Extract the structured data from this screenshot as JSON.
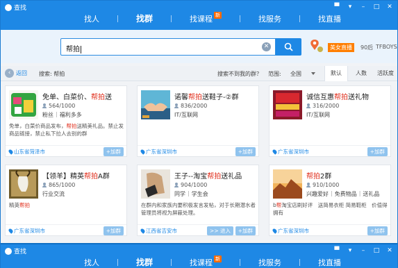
{
  "window": {
    "title": "查找"
  },
  "nav": {
    "tabs": [
      {
        "label": "找人",
        "active": false
      },
      {
        "label": "找群",
        "active": true
      },
      {
        "label": "找课程",
        "active": false,
        "badge": "新"
      },
      {
        "label": "找服务",
        "active": false
      },
      {
        "label": "找直播",
        "active": false
      }
    ]
  },
  "search": {
    "value": "帮拍"
  },
  "promo": {
    "tag": "美女直播",
    "words": [
      "90后",
      "TFBOYS"
    ]
  },
  "filter": {
    "back_label": "返回",
    "crumb": "搜索: 帮拍",
    "not_found": "搜索不到我的群？",
    "range_label": "范围:",
    "range_value": "全国",
    "sort": [
      "默认",
      "人数",
      "活跃度"
    ],
    "sort_active": 0
  },
  "cards": [
    {
      "name_pre": "免单、白菜价、",
      "name_hl": "帮拍",
      "name_post": "送",
      "members": "564/1000",
      "tags": [
        "粉丝",
        "福利多多"
      ],
      "desc_pre": "免单，白菜价商品发布，",
      "desc_hl": "帮拍",
      "desc_post": "送精美礼品。禁止发商品链接，禁止私下拉人去别的群",
      "location": "山东省菏泽市",
      "join": "+加群",
      "enter": ""
    },
    {
      "name_pre": "诺馨",
      "name_hl": "帮拍",
      "name_post": "送鞋子-②群",
      "members": "836/2000",
      "tags": [
        "IT/互联网"
      ],
      "desc_pre": "",
      "desc_hl": "",
      "desc_post": "",
      "location": "广东省深圳市",
      "join": "+加群",
      "enter": ""
    },
    {
      "name_pre": "诚信互惠",
      "name_hl": "帮拍",
      "name_post": "送礼物",
      "members": "316/2000",
      "tags": [
        "IT/互联网"
      ],
      "desc_pre": "",
      "desc_hl": "",
      "desc_post": "",
      "location": "广东省深圳市",
      "join": "+加群",
      "enter": ""
    },
    {
      "name_pre": "【领羊】精英",
      "name_hl": "帮拍",
      "name_post": "A群",
      "members": "865/1000",
      "tags": [
        "行业交流"
      ],
      "desc_pre": "精英",
      "desc_hl": "帮拍",
      "desc_post": "",
      "location": "广东省深圳市",
      "join": "+加群",
      "enter": ""
    },
    {
      "name_pre": "王子--淘宝",
      "name_hl": "帮拍",
      "name_post": "送礼品",
      "members": "904/1000",
      "tags": [
        "同学",
        "学生会"
      ],
      "desc_pre": "在群内和家族内要积极发言发帖，对于长期潜水者管理员将视为屏蔽处理。",
      "desc_hl": "",
      "desc_post": "",
      "location": "江西省吉安市",
      "join": "+加群",
      "enter": ">> 进入"
    },
    {
      "name_pre": "",
      "name_hl": "帮拍",
      "name_post": "2群",
      "members": "910/1000",
      "tags": [
        "兴趣爱好",
        "免费物品",
        "送礼品"
      ],
      "desc_pre": "b",
      "desc_hl": "帮",
      "desc_post": "淘宝店刷好评　送简易衣柜 简易鞋柜　价值得拥有",
      "location": "广东省深圳市",
      "join": "+加群",
      "enter": ""
    }
  ]
}
